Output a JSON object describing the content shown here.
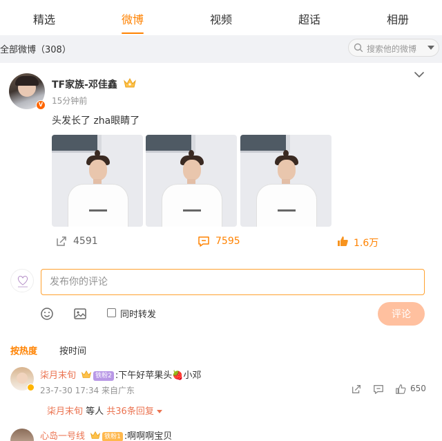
{
  "tabs": [
    {
      "label": "精选",
      "active": false
    },
    {
      "label": "微博",
      "active": true
    },
    {
      "label": "视频",
      "active": false
    },
    {
      "label": "超话",
      "active": false
    },
    {
      "label": "相册",
      "active": false
    }
  ],
  "filter": {
    "label": "全部微博（308）",
    "search_placeholder": "搜索他的微博"
  },
  "post": {
    "username": "TF家族-邓佳鑫",
    "time": "15分钟前",
    "text": "头发长了 zha眼睛了",
    "photo_count": 3,
    "reposts": "4591",
    "comments": "7595",
    "likes": "1.6万"
  },
  "composer": {
    "placeholder": "发布你的评论",
    "forward_label": "同时转发",
    "submit_label": "评论"
  },
  "sort": {
    "hot": "按热度",
    "time": "按时间"
  },
  "comments": [
    {
      "name": "柒月末旬",
      "badge": "铁粉2",
      "text": ":下午好苹果头🍓小邓",
      "meta": "23-7-30 17:34 来自广东",
      "likes": "650",
      "reply_name": "柒月末旬",
      "reply_mid": " 等人 ",
      "reply_count": "共36条回复"
    },
    {
      "name": "心岛一号线",
      "badge": "铁粉1",
      "text": ":啊啊啊宝贝"
    }
  ],
  "colors": {
    "accent": "#ff8200",
    "name": "#eb7350",
    "submit_disabled": "#ffc09f"
  }
}
